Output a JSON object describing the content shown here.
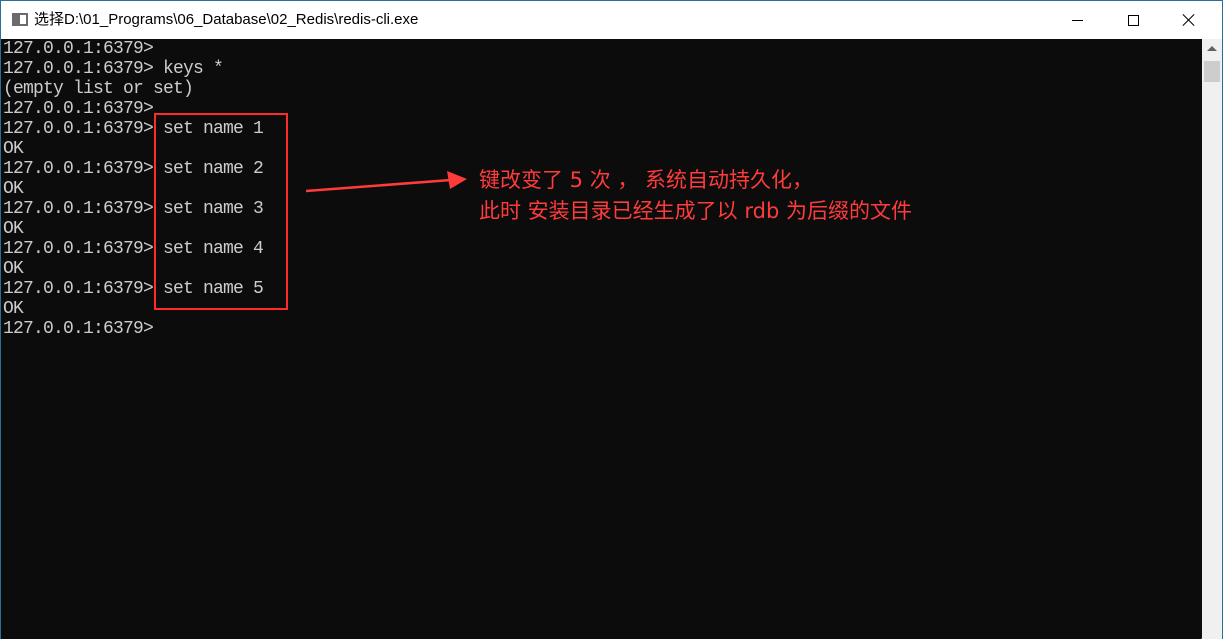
{
  "window": {
    "title": "选择D:\\01_Programs\\06_Database\\02_Redis\\redis-cli.exe"
  },
  "console": {
    "lines": [
      "127.0.0.1:6379>",
      "127.0.0.1:6379> keys *",
      "(empty list or set)",
      "127.0.0.1:6379>",
      "127.0.0.1:6379> set name 1",
      "OK",
      "127.0.0.1:6379> set name 2",
      "OK",
      "127.0.0.1:6379> set name 3",
      "OK",
      "127.0.0.1:6379> set name 4",
      "OK",
      "127.0.0.1:6379> set name 5",
      "OK",
      "127.0.0.1:6379>"
    ]
  },
  "annotation": {
    "line1": "键改变了 5 次 ， 系统自动持久化，",
    "line2": "此时 安装目录已经生成了以 rdb 为后缀的文件"
  },
  "colors": {
    "annotation": "#ff3b3b",
    "console_text": "#cccccc",
    "console_bg": "#0c0c0c"
  }
}
